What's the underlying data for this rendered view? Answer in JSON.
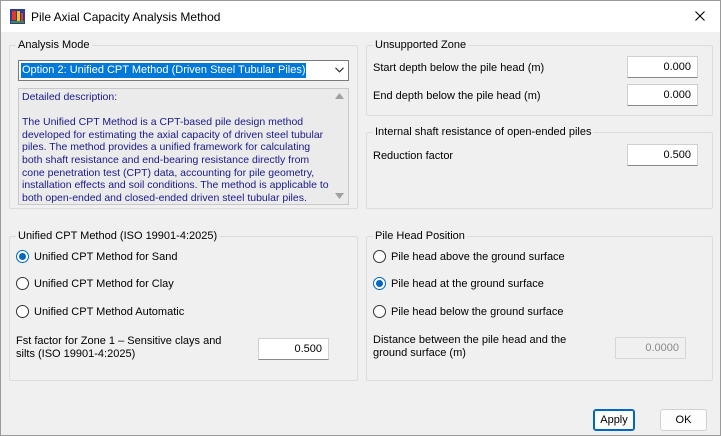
{
  "window": {
    "title": "Pile Axial Capacity Analysis Method",
    "app_icon": "app-logo-icon",
    "close_icon": "close-icon"
  },
  "analysis_mode": {
    "group_label": "Analysis Mode",
    "selected_option": "Option 2: Unified CPT Method (Driven Steel Tubular Piles)",
    "description": "Detailed description:\n\nThe Unified CPT Method is a CPT-based pile design method developed for estimating the axial capacity of driven steel tubular piles. The method provides a unified framework for calculating both shaft resistance and end-bearing resistance directly from cone penetration test (CPT) data, accounting for pile geometry, installation effects and soil conditions. The method is applicable to both open-ended and closed-ended driven steel tubular piles."
  },
  "unified_cpt": {
    "group_label": "Unified CPT Method (ISO 19901-4:2025)",
    "options": [
      {
        "label": "Unified CPT Method for Sand",
        "checked": true
      },
      {
        "label": "Unified CPT Method for Clay",
        "checked": false
      },
      {
        "label": "Unified CPT Method Automatic",
        "checked": false
      }
    ],
    "fst_label": "Fst factor for Zone 1 – Sensitive clays and silts (ISO 19901-4:2025)",
    "fst_value": "0.500"
  },
  "unsupported_zone": {
    "group_label": "Unsupported Zone",
    "start_label": "Start depth below the pile head (m)",
    "start_value": "0.000",
    "end_label": "End depth below the pile head (m)",
    "end_value": "0.000"
  },
  "internal_shaft": {
    "group_label": "Internal shaft resistance of open-ended piles",
    "reduction_label": "Reduction factor",
    "reduction_value": "0.500"
  },
  "pile_head": {
    "group_label": "Pile Head Position",
    "options": [
      {
        "label": "Pile head above the ground surface",
        "checked": false
      },
      {
        "label": "Pile head at the ground surface",
        "checked": true
      },
      {
        "label": "Pile head below the ground surface",
        "checked": false
      }
    ],
    "distance_label": "Distance between the pile head and the ground surface (m)",
    "distance_value": "0.0000"
  },
  "buttons": {
    "apply": "Apply",
    "ok": "OK"
  }
}
